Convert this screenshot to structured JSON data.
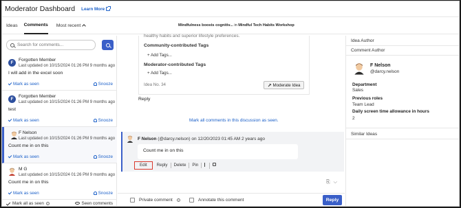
{
  "header": {
    "title": "Moderator Dashboard",
    "learn_more": "Learn More"
  },
  "tabs": {
    "ideas": "Ideas",
    "comments": "Comments",
    "sort": "Most recent"
  },
  "context": {
    "idea": "Mindfulness boosts cognitiv...",
    "in": "in",
    "workshop": "Mindful Tech Habits Workshop"
  },
  "search": {
    "placeholder": "Search for comments..."
  },
  "comments": [
    {
      "name": "Forgotten Member",
      "date": "Last updated on 10/15/2024 01:26 PM 9 months ago",
      "text": "I will add in the excel soon",
      "mark": "Mark as seen",
      "snooze": "Snooze"
    },
    {
      "name": "Forgotten Member",
      "date": "Last updated on 10/15/2024 01:26 PM 9 months ago",
      "text": "test",
      "mark": "Mark as seen",
      "snooze": "Snooze"
    },
    {
      "name": "F Nelson",
      "date": "Last updated on 10/15/2024 01:26 PM 9 months ago",
      "text": "Count me in on this",
      "mark": "Mark as seen",
      "snooze": "Snooze"
    },
    {
      "name": "M G",
      "date": "Last updated on 10/15/2024 01:26 PM 9 months ago",
      "text": "Count me in on this",
      "mark": "Mark as seen",
      "snooze": "Snooze"
    }
  ],
  "left_footer": {
    "mark_all": "Mark all as seen",
    "seen": "Seen comments"
  },
  "idea": {
    "faded_text": "healthy habits and superior lifestyle preferences.",
    "community_tags": "Community-contributed Tags",
    "moderator_tags": "Moderator-contributed Tags",
    "add_tags": "+ Add Tags...",
    "idea_no": "Idea No. 34",
    "moderate": "Moderate Idea",
    "reply": "Reply"
  },
  "mark_all_discussion": "Mark all comments in this discussion as seen.",
  "thread": {
    "author": "F Nelson",
    "meta": "(@darcy.nelson) on 12/20/2023 01:45 AM 2 years ago",
    "text": "Count me in on this",
    "actions": {
      "edit": "Edit",
      "reply": "Reply",
      "delete": "Delete",
      "pin": "Pin"
    }
  },
  "composer": {
    "private": "Private comment",
    "annotate": "Annotate this comment",
    "reply": "Reply"
  },
  "right": {
    "idea_author": "Idea Author",
    "comment_author": "Comment Author",
    "name": "F Nelson",
    "handle": "@darcy.nelson",
    "department_label": "Department",
    "department": "Sales",
    "roles_label": "Previous roles",
    "roles": "Team Lead",
    "screen_label": "Daily screen time allowance in hours",
    "screen": "2",
    "similar": "Similar Ideas"
  },
  "colors": {
    "accent": "#3a5fc8",
    "link": "#1a5fc8",
    "highlight": "#d9372b"
  }
}
